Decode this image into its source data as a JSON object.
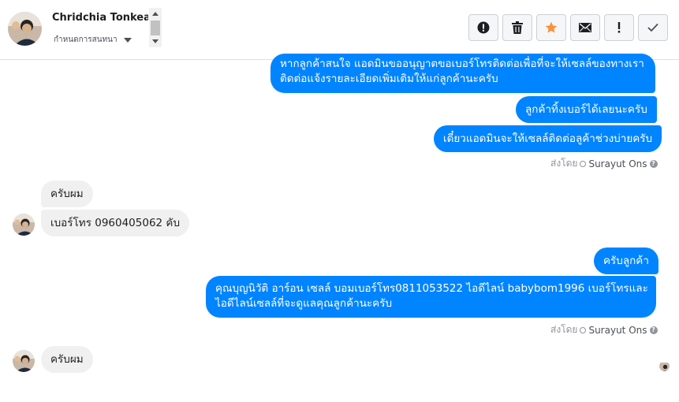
{
  "header": {
    "contact_name": "Chridchia Tonkeaw",
    "subtitle": "กำหนดการสนทนา",
    "toolbar": [
      {
        "icon": "alert-circle-icon",
        "glyph": "!"
      },
      {
        "icon": "trash-icon",
        "glyph": "🗑"
      },
      {
        "icon": "star-icon",
        "glyph": "★"
      },
      {
        "icon": "envelope-icon",
        "glyph": "✉"
      },
      {
        "icon": "exclamation-icon",
        "glyph": "!"
      },
      {
        "icon": "check-icon",
        "glyph": "✓"
      }
    ]
  },
  "messages": {
    "m1": "หากลูกค้าสนใจ แอดมินขออนุญาตขอเบอร์โทรติดต่อเพื่อที่จะให้เซลล์ของทางเรา",
    "m1b": "ติดต่อแจ้งรายละเอียดเพิ่มเติมให้แก่ลูกค้านะครับ",
    "m2": "ลูกค้าทิ้งเบอร์ได้เลยนะครับ",
    "m3": "เดี๋ยวแอดมินจะให้เซลล์ติดต่อลูค้าช่วงบ่ายครับ",
    "sent1_prefix": "ส่งโดย",
    "sent1_name": "Surayut Ons",
    "m4": "ครับผม",
    "m5": "เบอร์โทร 0960405062 คับ",
    "m6": "ครับลูกค้า",
    "m7": "คุณบุญนิวัติ อาร์อน เซลล์ บอมเบอร์โทร0811053522 ไอดีไลน์ babybom1996  เบอร์โทรและ",
    "m7b": "ไอดีไลน์เซลล์ที่จะดูแลคุณลูกค้านะครับ",
    "sent2_prefix": "ส่งโดย",
    "sent2_name": "Surayut Ons",
    "m8": "ครับผม"
  },
  "colors": {
    "outgoing": "#0084ff",
    "incoming": "#f1f0f0",
    "star": "#f7923a"
  }
}
